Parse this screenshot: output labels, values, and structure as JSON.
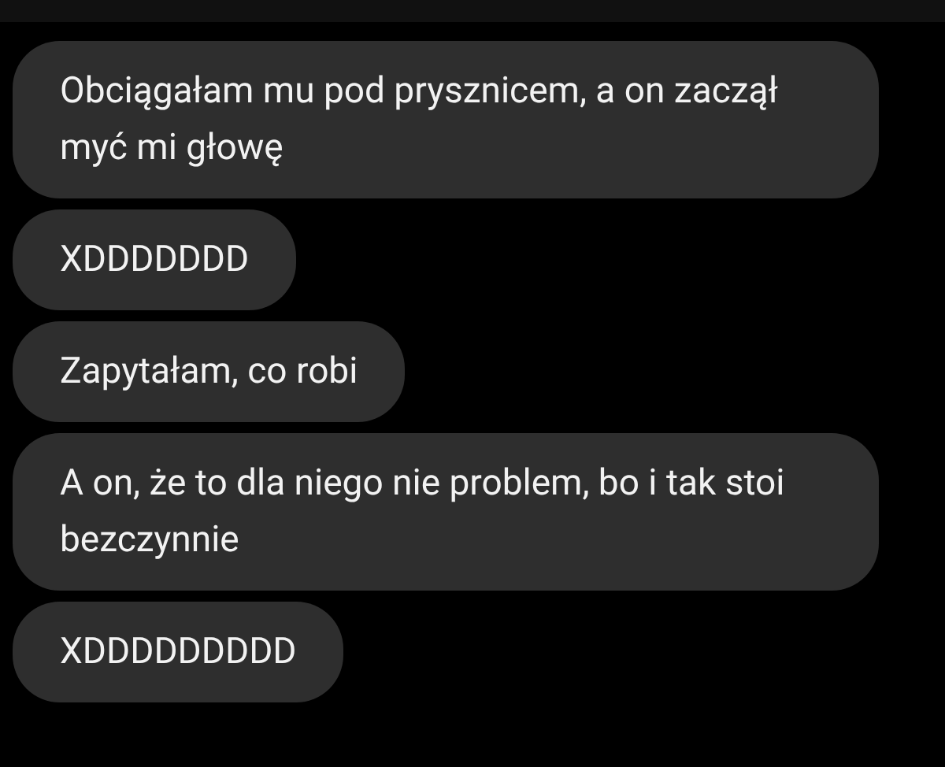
{
  "messages": [
    {
      "text": "Obciągałam mu pod prysznicem, a on zaczął myć mi głowę"
    },
    {
      "text": "XDDDDDDD"
    },
    {
      "text": "Zapytałam, co robi"
    },
    {
      "text": "A on, że to dla niego nie problem, bo i tak stoi bezczynnie"
    },
    {
      "text": "XDDDDDDDDD"
    }
  ]
}
